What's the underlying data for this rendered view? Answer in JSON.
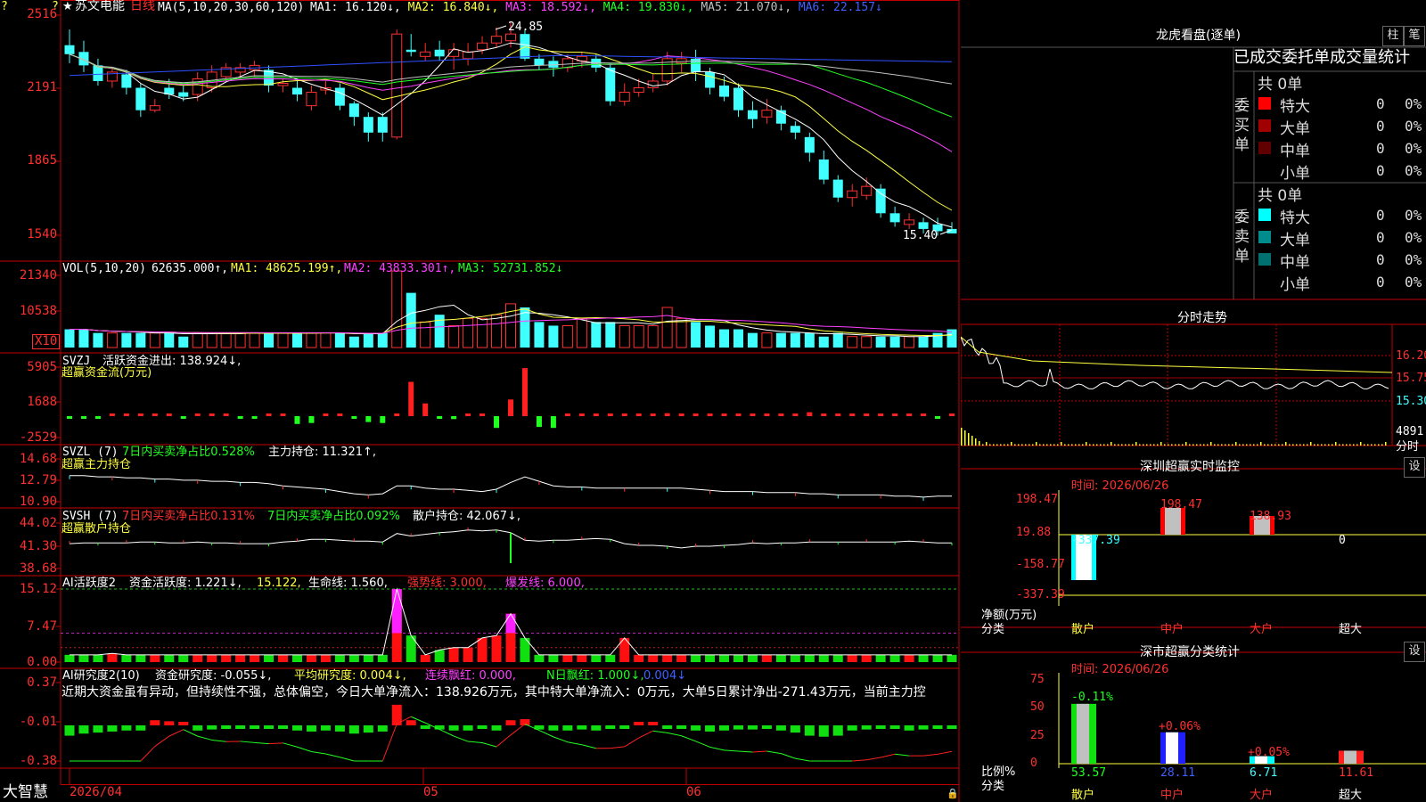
{
  "stock": {
    "name": "苏文电能",
    "period": "日线",
    "star": "★"
  },
  "main_chart": {
    "ma_line": "MA(5,10,20,30,60,120)",
    "ma_values": [
      {
        "label": "MA1: 16.120↓,",
        "color": "#ffffff"
      },
      {
        "label": "MA2: 16.840↓,",
        "color": "#ffff40"
      },
      {
        "label": "MA3: 18.592↓,",
        "color": "#ff40ff"
      },
      {
        "label": "MA4: 19.830↓,",
        "color": "#20ff20"
      },
      {
        "label": "MA5: 21.070↓,",
        "color": "#c0c0c0"
      },
      {
        "label": "MA6: 22.157↓",
        "color": "#4060ff"
      }
    ],
    "y_ticks": [
      "2516",
      "2191",
      "1865",
      "1540"
    ],
    "high_label": "24.85",
    "low_label": "15.40"
  },
  "chart_data": [
    {
      "type": "candlestick",
      "title": "苏文电能 日线",
      "x_labels": [
        "2026/04",
        "05",
        "06"
      ],
      "y_ticks": [
        "2516",
        "2191",
        "1865",
        "1540"
      ],
      "candles": [
        {
          "o": 23.8,
          "c": 23.4,
          "h": 24.5,
          "l": 23.0
        },
        {
          "o": 23.5,
          "c": 22.9,
          "h": 24.0,
          "l": 22.6
        },
        {
          "o": 22.9,
          "c": 22.2,
          "h": 23.2,
          "l": 22.0
        },
        {
          "o": 22.2,
          "c": 22.6,
          "h": 22.8,
          "l": 21.9
        },
        {
          "o": 22.5,
          "c": 21.9,
          "h": 22.7,
          "l": 21.6
        },
        {
          "o": 21.9,
          "c": 20.9,
          "h": 22.1,
          "l": 20.6
        },
        {
          "o": 20.9,
          "c": 21.1,
          "h": 21.4,
          "l": 20.8
        },
        {
          "o": 21.9,
          "c": 21.6,
          "h": 22.3,
          "l": 21.4
        },
        {
          "o": 21.7,
          "c": 21.5,
          "h": 22.0,
          "l": 21.3
        },
        {
          "o": 21.6,
          "c": 22.3,
          "h": 22.6,
          "l": 21.3
        },
        {
          "o": 21.9,
          "c": 22.6,
          "h": 22.9,
          "l": 21.7
        },
        {
          "o": 22.4,
          "c": 22.8,
          "h": 23.0,
          "l": 22.2
        },
        {
          "o": 22.6,
          "c": 22.8,
          "h": 23.0,
          "l": 22.3
        },
        {
          "o": 22.7,
          "c": 22.9,
          "h": 23.1,
          "l": 22.4
        },
        {
          "o": 22.7,
          "c": 22.0,
          "h": 22.9,
          "l": 21.7
        },
        {
          "o": 22.0,
          "c": 22.1,
          "h": 22.3,
          "l": 21.7
        },
        {
          "o": 21.9,
          "c": 21.6,
          "h": 22.3,
          "l": 21.3
        },
        {
          "o": 21.1,
          "c": 21.7,
          "h": 22.0,
          "l": 20.9
        },
        {
          "o": 21.8,
          "c": 21.9,
          "h": 22.2,
          "l": 21.6
        },
        {
          "o": 21.9,
          "c": 21.1,
          "h": 22.1,
          "l": 20.9
        },
        {
          "o": 21.2,
          "c": 20.6,
          "h": 21.3,
          "l": 20.2
        },
        {
          "o": 20.6,
          "c": 19.9,
          "h": 20.8,
          "l": 19.5
        },
        {
          "o": 20.6,
          "c": 19.9,
          "h": 20.8,
          "l": 19.5
        },
        {
          "o": 19.7,
          "c": 24.3,
          "h": 24.5,
          "l": 19.6
        },
        {
          "o": 23.6,
          "c": 23.5,
          "h": 24.3,
          "l": 23.3
        },
        {
          "o": 23.3,
          "c": 23.5,
          "h": 23.9,
          "l": 23.1
        },
        {
          "o": 23.6,
          "c": 23.3,
          "h": 24.0,
          "l": 23.1
        },
        {
          "o": 23.3,
          "c": 23.6,
          "h": 23.9,
          "l": 22.7
        },
        {
          "o": 23.2,
          "c": 23.5,
          "h": 23.9,
          "l": 22.9
        },
        {
          "o": 23.6,
          "c": 23.9,
          "h": 24.2,
          "l": 23.4
        },
        {
          "o": 23.9,
          "c": 24.2,
          "h": 24.6,
          "l": 23.7
        },
        {
          "o": 24.0,
          "c": 24.3,
          "h": 24.85,
          "l": 23.7
        },
        {
          "o": 24.3,
          "c": 23.2,
          "h": 24.5,
          "l": 23.1
        },
        {
          "o": 23.2,
          "c": 22.9,
          "h": 23.4,
          "l": 22.7
        },
        {
          "o": 23.1,
          "c": 22.8,
          "h": 23.3,
          "l": 22.4
        },
        {
          "o": 22.8,
          "c": 23.2,
          "h": 23.4,
          "l": 22.6
        },
        {
          "o": 23.1,
          "c": 23.3,
          "h": 23.5,
          "l": 22.8
        },
        {
          "o": 23.2,
          "c": 22.8,
          "h": 23.4,
          "l": 22.6
        },
        {
          "o": 22.8,
          "c": 21.3,
          "h": 23.0,
          "l": 21.1
        },
        {
          "o": 21.3,
          "c": 21.7,
          "h": 22.1,
          "l": 21.1
        },
        {
          "o": 21.7,
          "c": 21.9,
          "h": 22.3,
          "l": 21.5
        },
        {
          "o": 21.9,
          "c": 22.2,
          "h": 22.5,
          "l": 21.7
        },
        {
          "o": 22.2,
          "c": 23.2,
          "h": 23.5,
          "l": 22.0
        },
        {
          "o": 23.0,
          "c": 23.2,
          "h": 23.5,
          "l": 22.6
        },
        {
          "o": 23.2,
          "c": 22.6,
          "h": 23.6,
          "l": 22.2
        },
        {
          "o": 22.6,
          "c": 21.9,
          "h": 22.8,
          "l": 21.6
        },
        {
          "o": 22.0,
          "c": 21.5,
          "h": 22.4,
          "l": 21.3
        },
        {
          "o": 21.9,
          "c": 20.9,
          "h": 22.1,
          "l": 20.6
        },
        {
          "o": 20.9,
          "c": 20.5,
          "h": 21.3,
          "l": 20.1
        },
        {
          "o": 20.6,
          "c": 20.9,
          "h": 21.4,
          "l": 20.3
        },
        {
          "o": 20.9,
          "c": 20.3,
          "h": 21.1,
          "l": 20.0
        },
        {
          "o": 20.2,
          "c": 19.9,
          "h": 20.4,
          "l": 19.6
        },
        {
          "o": 19.7,
          "c": 19.0,
          "h": 19.9,
          "l": 18.6
        },
        {
          "o": 18.7,
          "c": 17.8,
          "h": 19.1,
          "l": 17.6
        },
        {
          "o": 17.8,
          "c": 17.0,
          "h": 18.0,
          "l": 16.8
        },
        {
          "o": 17.0,
          "c": 17.3,
          "h": 17.6,
          "l": 16.6
        },
        {
          "o": 17.1,
          "c": 17.5,
          "h": 17.9,
          "l": 16.9
        },
        {
          "o": 17.4,
          "c": 16.3,
          "h": 17.6,
          "l": 16.1
        },
        {
          "o": 16.3,
          "c": 15.9,
          "h": 16.6,
          "l": 15.7
        },
        {
          "o": 15.8,
          "c": 16.0,
          "h": 16.3,
          "l": 15.6
        },
        {
          "o": 15.9,
          "c": 15.6,
          "h": 16.1,
          "l": 15.4
        },
        {
          "o": 15.8,
          "c": 15.5,
          "h": 16.1,
          "l": 15.3
        },
        {
          "o": 15.6,
          "c": 15.4,
          "h": 15.9,
          "l": 15.4
        }
      ]
    },
    {
      "type": "bar",
      "title": "VOL(5,10,20)",
      "y_ticks": [
        "21340",
        "10538"
      ],
      "unit": "X10",
      "values": [
        5,
        5,
        4,
        4,
        4,
        4,
        4,
        4,
        3,
        4,
        4,
        4,
        4,
        4,
        4,
        4,
        4,
        4,
        4,
        4,
        3,
        4,
        4,
        21,
        15,
        7,
        9,
        6,
        8,
        8,
        9,
        12,
        11,
        7,
        6,
        6,
        8,
        7,
        7,
        6,
        6,
        6,
        11,
        8,
        7,
        6,
        5,
        5,
        4,
        4,
        4,
        4,
        4,
        3,
        4,
        3,
        3,
        3,
        3,
        3,
        3,
        4,
        5
      ]
    },
    {
      "type": "bar",
      "title": "SVZJ 活跃资金进出",
      "y_ticks": [
        "5905",
        "1688",
        "-2529"
      ],
      "values": [
        -50,
        -100,
        -80,
        0,
        100,
        50,
        0,
        0,
        -100,
        50,
        100,
        0,
        -50,
        -80,
        0,
        0,
        -800,
        -700,
        0,
        0,
        -100,
        -600,
        -700,
        0,
        3500,
        1300,
        -200,
        -300,
        0,
        0,
        -1200,
        1700,
        4900,
        -1100,
        -1200,
        0,
        0,
        0,
        0,
        0,
        0,
        0,
        300,
        0,
        0,
        0,
        0,
        0,
        0,
        0,
        0,
        0,
        400,
        100,
        0,
        0,
        0,
        0,
        0,
        0,
        0,
        -200,
        100
      ]
    },
    {
      "type": "line",
      "title": "SVZL (7)",
      "y_ticks": [
        "14.68",
        "12.79",
        "10.90"
      ],
      "values": [
        13.2,
        13.2,
        13.1,
        13.1,
        13.0,
        13.0,
        12.9,
        12.9,
        12.8,
        12.8,
        12.7,
        12.7,
        12.6,
        12.6,
        12.5,
        12.3,
        12.2,
        12.1,
        12.0,
        11.8,
        11.6,
        11.5,
        11.6,
        12.3,
        12.3,
        12.1,
        12.0,
        12.0,
        11.9,
        11.8,
        12.0,
        12.6,
        13.1,
        12.7,
        12.3,
        12.2,
        12.2,
        12.1,
        12.1,
        12.1,
        12.1,
        12.1,
        12.1,
        12.1,
        12.0,
        11.9,
        11.8,
        11.8,
        11.8,
        11.7,
        11.7,
        11.7,
        11.6,
        11.6,
        11.5,
        11.5,
        11.5,
        11.5,
        11.4,
        11.4,
        11.3,
        11.4,
        11.4
      ]
    },
    {
      "type": "line",
      "title": "SVSH (7)",
      "y_ticks": [
        "44.02",
        "41.30",
        "38.68"
      ],
      "values": [
        41.6,
        41.7,
        41.7,
        41.7,
        41.7,
        41.8,
        41.8,
        41.7,
        41.7,
        41.8,
        41.7,
        41.7,
        41.6,
        41.6,
        41.6,
        41.8,
        41.9,
        42.1,
        42.1,
        42.0,
        41.9,
        41.9,
        41.8,
        42.8,
        42.5,
        42.7,
        42.9,
        43.0,
        43.2,
        43.1,
        43.2,
        42.9,
        42.0,
        41.9,
        42.0,
        42.0,
        42.1,
        42.2,
        42.1,
        41.6,
        41.4,
        41.4,
        41.3,
        41.1,
        41.3,
        41.3,
        41.4,
        41.5,
        41.7,
        41.6,
        41.7,
        41.7,
        41.8,
        41.8,
        41.8,
        41.8,
        41.8,
        41.8,
        41.8,
        41.9,
        41.8,
        41.7,
        41.7
      ]
    },
    {
      "type": "bar",
      "title": "AI活跃度2",
      "y_ticks": [
        "15.12",
        "7.47",
        "0.00"
      ],
      "values": [
        1.5,
        1.5,
        1.5,
        1.8,
        1.5,
        1.5,
        1.5,
        1.5,
        1.5,
        1.5,
        1.5,
        1.5,
        1.5,
        1.5,
        1.5,
        1.5,
        1.5,
        1.5,
        1.5,
        1.5,
        1.5,
        1.5,
        1.5,
        15.1,
        5.5,
        1.5,
        2.5,
        3,
        3,
        5,
        5.5,
        10,
        5,
        1.5,
        1.5,
        1.5,
        1.5,
        1.5,
        1.5,
        5,
        1.5,
        1.5,
        1.5,
        1.5,
        1.5,
        1.5,
        1.5,
        1.5,
        1.5,
        1.5,
        1.5,
        1.5,
        1.5,
        1.5,
        1.5,
        1.5,
        1.5,
        1.5,
        1.5,
        1.5,
        1.5,
        1.5,
        1.5
      ]
    },
    {
      "type": "bar",
      "title": "AI研究度2(10)",
      "y_ticks": [
        "0.37",
        "-0.01",
        "-0.38"
      ],
      "values": [
        -0.1,
        -0.08,
        -0.07,
        -0.06,
        -0.05,
        -0.05,
        0.05,
        0.04,
        0.03,
        -0.05,
        -0.04,
        -0.03,
        -0.02,
        -0.03,
        -0.03,
        -0.02,
        -0.05,
        -0.06,
        -0.05,
        -0.06,
        -0.08,
        -0.07,
        -0.06,
        0.2,
        0.05,
        -0.03,
        -0.04,
        -0.05,
        -0.05,
        -0.03,
        -0.05,
        0.05,
        0.06,
        -0.04,
        -0.05,
        -0.05,
        -0.04,
        -0.05,
        -0.03,
        -0.02,
        0.03,
        0.03,
        -0.02,
        -0.03,
        -0.05,
        -0.06,
        -0.05,
        -0.04,
        -0.04,
        -0.03,
        -0.05,
        -0.07,
        -0.1,
        -0.11,
        -0.1,
        -0.05,
        -0.04,
        -0.03,
        -0.02,
        -0.05,
        -0.04,
        -0.03,
        -0.02
      ]
    }
  ],
  "vol": {
    "title": "VOL(5,10,20)",
    "value": "62635.000↑,",
    "ma1": "MA1: 48625.199↑,",
    "ma2": "MA2: 43833.301↑,",
    "ma3": "MA3: 52731.852↓",
    "y_ticks": [
      "21340",
      "10538"
    ],
    "unit": "X10"
  },
  "svzj": {
    "title": "SVZJ",
    "label": "活跃资金进出: 138.924↓,",
    "subtitle": "超赢资金流(万元)",
    "y_ticks": [
      "5905",
      "1688",
      "-2529"
    ]
  },
  "svzl": {
    "title": "SVZL (7)",
    "label1": "7日内买卖净占比0.528%",
    "label2": "主力持仓: 11.321↑,",
    "subtitle": "超赢主力持仓",
    "y_ticks": [
      "14.68",
      "12.79",
      "10.90"
    ]
  },
  "svsh": {
    "title": "SVSH (7)",
    "label1": "7日内买卖净占比0.131%",
    "label2": "7日内买卖净占比0.092%",
    "label3": "散户持仓: 42.067↓,",
    "subtitle": "超赢散户持仓",
    "y_ticks": [
      "44.02",
      "41.30",
      "38.68"
    ]
  },
  "ai_active": {
    "title": "AI活跃度2",
    "label1": "资金活跃度: 1.221↓,",
    "label2": "15.122,",
    "label3": "生命线: 1.560,",
    "label4": "强势线: 3.000,",
    "label5": "爆发线: 6.000,",
    "y_ticks": [
      "15.12",
      "7.47",
      "0.00"
    ]
  },
  "ai_research": {
    "title": "AI研究度2(10)",
    "label1": "资金研究度: -0.055↓,",
    "label2": "平均研究度: 0.004↓,",
    "label3": "连续飘红: 0.000,",
    "label4": "N日飘红: 1.000↓,",
    "label5": "0.004↓",
    "comment": "近期大资金虽有异动，但持续性不强，总体偏空，今日大单净流入：138.926万元，其中特大单净流入：0万元，大单5日累计净出-271.43万元，当前主力控",
    "y_ticks": [
      "0.37",
      "-0.01",
      "-0.38"
    ]
  },
  "x_axis": {
    "labels": [
      "2026/04",
      "05",
      "06"
    ]
  },
  "footer": {
    "brand": "大智慧"
  },
  "dragon": {
    "title": "龙虎看盘(逐单)",
    "btn_bar": "柱",
    "btn_pen": "笔",
    "tabs": "已成交委托单成交量统计",
    "buy": {
      "group_label": "委买单",
      "total": "共 0单",
      "rows": [
        {
          "label": "特大",
          "count": "0",
          "pct": "0%",
          "color": "#ff0000"
        },
        {
          "label": "大单",
          "count": "0",
          "pct": "0%",
          "color": "#a00000"
        },
        {
          "label": "中单",
          "count": "0",
          "pct": "0%",
          "color": "#600000"
        },
        {
          "label": "小单",
          "count": "0",
          "pct": "0%",
          "color": "#000000"
        }
      ]
    },
    "sell": {
      "group_label": "委卖单",
      "total": "共 0单",
      "rows": [
        {
          "label": "特大",
          "count": "0",
          "pct": "0%",
          "color": "#00ffff"
        },
        {
          "label": "大单",
          "count": "0",
          "pct": "0%",
          "color": "#008c8c"
        },
        {
          "label": "中单",
          "count": "0",
          "pct": "0%",
          "color": "#007070"
        },
        {
          "label": "小单",
          "count": "0",
          "pct": "0%",
          "color": "#000000"
        }
      ]
    }
  },
  "intraday": {
    "title": "分时走势",
    "prices": [
      "16.20",
      "15.75",
      "15.30"
    ],
    "vol_top": "4891",
    "vol_label": "分时"
  },
  "sz_monitor": {
    "title": "深圳超赢实时监控",
    "settings": "设",
    "time": "时间: 2026/06/26",
    "y_ticks": [
      "198.47",
      "19.88",
      "-158.77",
      "-337.39"
    ],
    "y_caption": "净额(万元)",
    "x_caption": "分类",
    "categories": [
      "散户",
      "中户",
      "大户",
      "超大"
    ],
    "values": [
      -337.39,
      198.47,
      138.93,
      0
    ],
    "value_labels": [
      "-337.39",
      "198.47",
      "138.93",
      "0"
    ]
  },
  "sz_stats": {
    "title": "深市超赢分类统计",
    "settings": "设",
    "time": "时间: 2026/06/26",
    "y_ticks": [
      "75",
      "50",
      "25",
      "0"
    ],
    "y_caption": "比例%",
    "x_caption": "分类",
    "categories": [
      "散户",
      "中户",
      "大户",
      "超大"
    ],
    "percents": [
      53.57,
      28.11,
      6.71,
      11.61
    ],
    "percent_labels": [
      "53.57",
      "28.11",
      "6.71",
      "11.61"
    ],
    "changes": [
      "-0.11%",
      "+0.06%",
      "+0.05%",
      ""
    ]
  },
  "colors": {
    "up": "#ff3030",
    "down": "#40ffff",
    "frame": "#c00000",
    "ma1": "#ffffff",
    "ma2": "#ffff40",
    "ma3": "#ff40ff",
    "ma4": "#20ff20",
    "ma5": "#c0c0c0",
    "ma6": "#3050ff"
  }
}
